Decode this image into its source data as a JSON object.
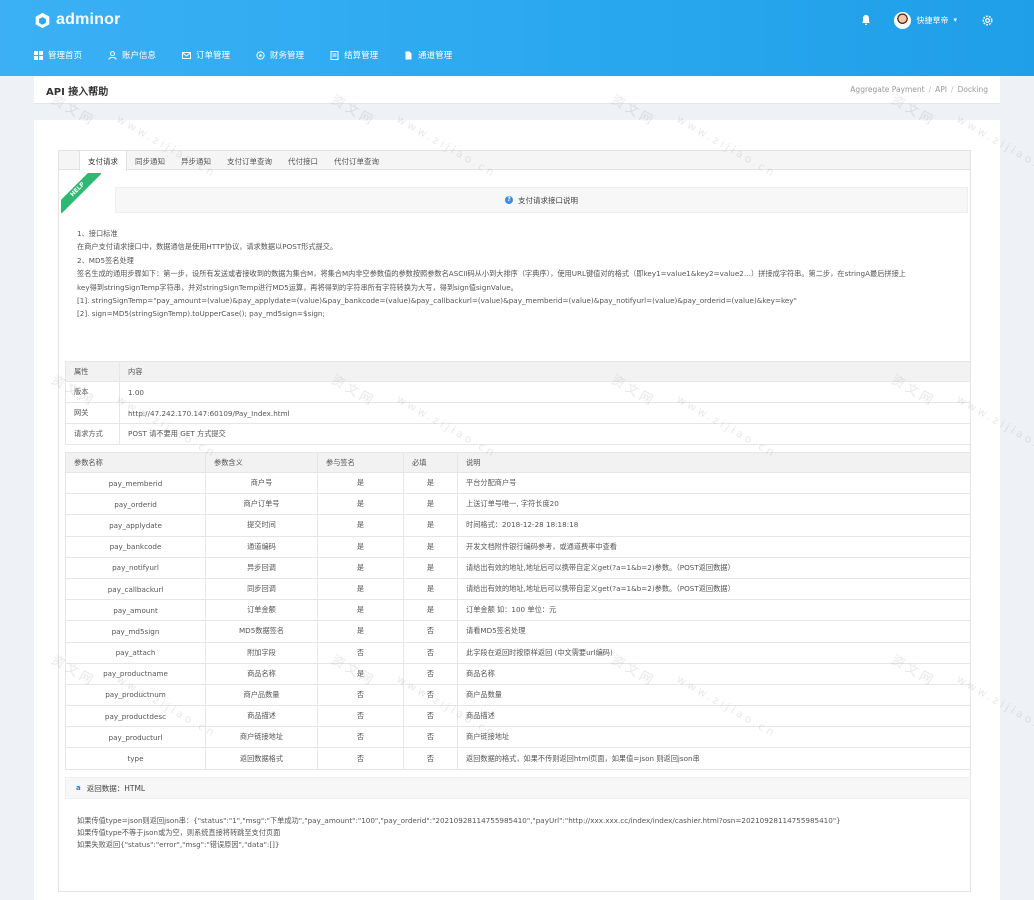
{
  "brand": {
    "name": "adminor"
  },
  "user": {
    "name": "快捷草帝"
  },
  "nav": [
    {
      "label": "管理首页",
      "icon": "grid-icon"
    },
    {
      "label": "账户信息",
      "icon": "user-icon"
    },
    {
      "label": "订单管理",
      "icon": "mail-icon"
    },
    {
      "label": "财务管理",
      "icon": "settings-icon"
    },
    {
      "label": "结算管理",
      "icon": "list-icon"
    },
    {
      "label": "通道管理",
      "icon": "file-icon"
    }
  ],
  "page": {
    "title": "API 接入帮助",
    "breadcrumb": [
      "Aggregate Payment",
      "API",
      "Docking"
    ]
  },
  "tabs": [
    "支付请求",
    "同步通知",
    "异步通知",
    "支付订单查询",
    "代付接口",
    "代付订单查询"
  ],
  "help_ribbon": "HELP",
  "info_title": "支付请求接口说明",
  "description": [
    "1、接口标准",
    "在商户支付请求接口中，数据通信是使用HTTP协议，请求数据以POST形式提交。",
    "2、MD5签名处理",
    "签名生成的通用步骤如下：第一步，设所有发送或者接收到的数据为集合M，将集合M内非空参数值的参数按照参数名ASCII码从小到大排序（字典序），使用URL键值对的格式（即key1=value1&key2=value2…）拼接成字符串。第二步，在stringA最后拼接上",
    "key得到stringSignTemp字符串，并对stringSignTemp进行MD5运算，再将得到的字符串所有字符转换为大写，得到sign值signValue。",
    "[1]. stringSignTemp=\"pay_amount=(value)&pay_applydate=(value)&pay_bankcode=(value)&pay_callbackurl=(value)&pay_memberid=(value)&pay_notifyurl=(value)&pay_orderid=(value)&key=key\"",
    "[2]. sign=MD5(stringSignTemp).toUpperCase(); pay_md5sign=$sign;"
  ],
  "info_table": {
    "header": [
      "属性",
      "内容"
    ],
    "rows": [
      [
        "版本",
        "1.00"
      ],
      [
        "网关",
        "http://47.242.170.147:60109/Pay_Index.html"
      ],
      [
        "请求方式",
        "POST 请不要用 GET 方式提交"
      ]
    ]
  },
  "param_table": {
    "header": [
      "参数名称",
      "参数含义",
      "参与签名",
      "必填",
      "说明"
    ],
    "rows": [
      [
        "pay_memberid",
        "商户号",
        "是",
        "是",
        "平台分配商户号"
      ],
      [
        "pay_orderid",
        "商户订单号",
        "是",
        "是",
        "上送订单号唯一, 字符长度20"
      ],
      [
        "pay_applydate",
        "提交时间",
        "是",
        "是",
        "时间格式：2018-12-28 18:18:18"
      ],
      [
        "pay_bankcode",
        "通道编码",
        "是",
        "是",
        "开发文档附件银行编码参考，或通道费率中查看"
      ],
      [
        "pay_notifyurl",
        "异步回调",
        "是",
        "是",
        "请给出有效的地址,地址后可以携带自定义get(?a=1&b=2)参数。（POST返回数据）"
      ],
      [
        "pay_callbackurl",
        "同步回调",
        "是",
        "是",
        "请给出有效的地址,地址后可以携带自定义get(?a=1&b=2)参数。（POST返回数据）"
      ],
      [
        "pay_amount",
        "订单金额",
        "是",
        "是",
        "订单金额 如：100 单位：元"
      ],
      [
        "pay_md5sign",
        "MD5数据签名",
        "是",
        "否",
        "请看MD5签名处理"
      ],
      [
        "pay_attach",
        "附加字段",
        "否",
        "否",
        "此字段在返回时按原样返回 (中文需要url编码)"
      ],
      [
        "pay_productname",
        "商品名称",
        "是",
        "否",
        "商品名称"
      ],
      [
        "pay_productnum",
        "商户品数量",
        "否",
        "否",
        "商户品数量"
      ],
      [
        "pay_productdesc",
        "商品描述",
        "否",
        "否",
        "商品描述"
      ],
      [
        "pay_producturl",
        "商户链接地址",
        "否",
        "否",
        "商户链接地址"
      ],
      [
        "type",
        "返回数据格式",
        "否",
        "否",
        "返回数据的格式，如果不传则返回html页面，如果值=json 则返回json串"
      ]
    ]
  },
  "return_title": "返回数据：HTML",
  "return_desc": [
    "如果传值type=json则返回json串：{\"status\":\"1\",\"msg\":\"下单成功\",\"pay_amount\":\"100\",\"pay_orderid\":\"20210928114755985410\",\"payUrl\":\"http://xxx.xxx.cc/index/index/cashier.html?osn=20210928114755985410\"}",
    "如果传值type不等于json或为空，则系统直接将转跳至支付页面",
    "如果失败返回{\"status\":\"error\",\"msg\":\"错误原因\",\"data\":[]}"
  ],
  "watermark": {
    "site": "资文网",
    "url": "www.zijiao.cn"
  },
  "colors": {
    "header_gradient_start": "#3bb0f5",
    "header_gradient_end": "#1f9fe8",
    "help_green": "#2eb872",
    "info_blue": "#3a8ee6"
  }
}
